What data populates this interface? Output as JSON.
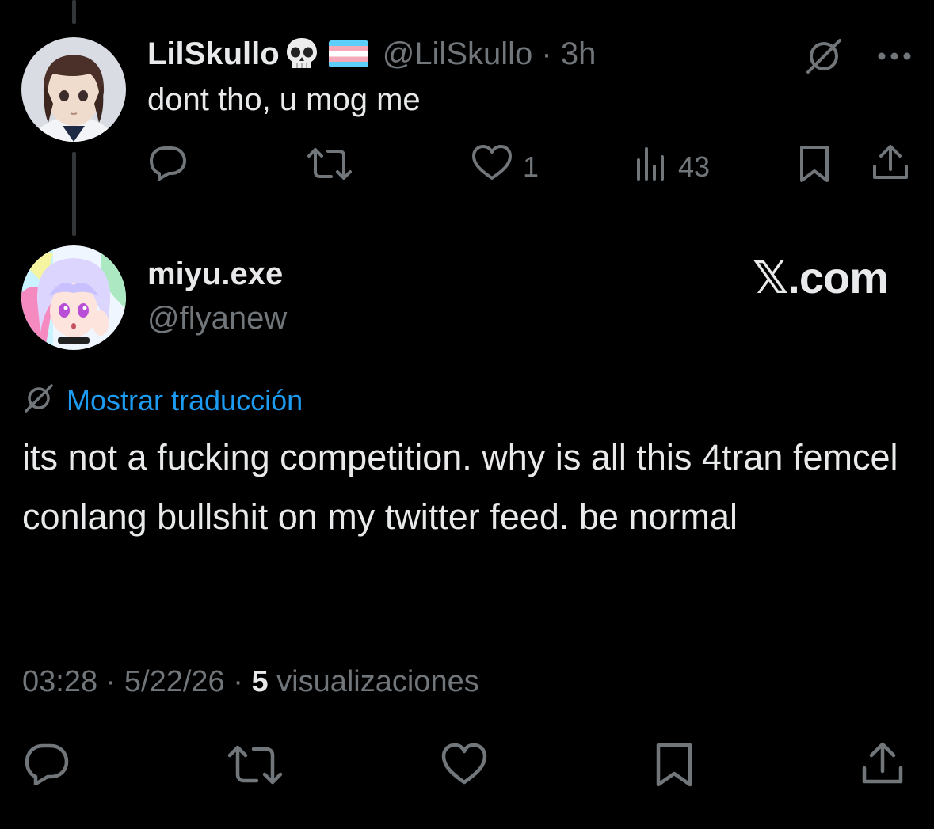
{
  "reply": {
    "display_name": "LilSkullo",
    "emojis": [
      "skull-emoji",
      "trans-flag-emoji"
    ],
    "handle": "@LilSkullo",
    "separator": "·",
    "time": "3h",
    "text": "dont tho, u mog me",
    "likes_count": "1",
    "views_count": "43",
    "icons": {
      "grok": "slashed-circle-icon",
      "more": "more-dots-icon",
      "reply": "reply-icon",
      "retweet": "retweet-icon",
      "like": "heart-icon",
      "views": "analytics-icon",
      "bookmark": "bookmark-icon",
      "share": "share-icon"
    }
  },
  "tweet": {
    "display_name": "miyu.exe",
    "handle": "@flyanew",
    "watermark": "𝕏.com",
    "translate_label": "Mostrar traducción",
    "text": "its not a fucking competition. why is all this 4tran femcel conlang bullshit on my twitter feed. be normal",
    "time": "03:28",
    "date": "5/22/26",
    "separator": "·",
    "views_count": "5",
    "views_label": "visualizaciones"
  },
  "colors": {
    "background": "#000000",
    "text_primary": "#e7e9ea",
    "text_secondary": "#71767b",
    "link": "#1d9bf0",
    "thread_line": "#333639"
  }
}
